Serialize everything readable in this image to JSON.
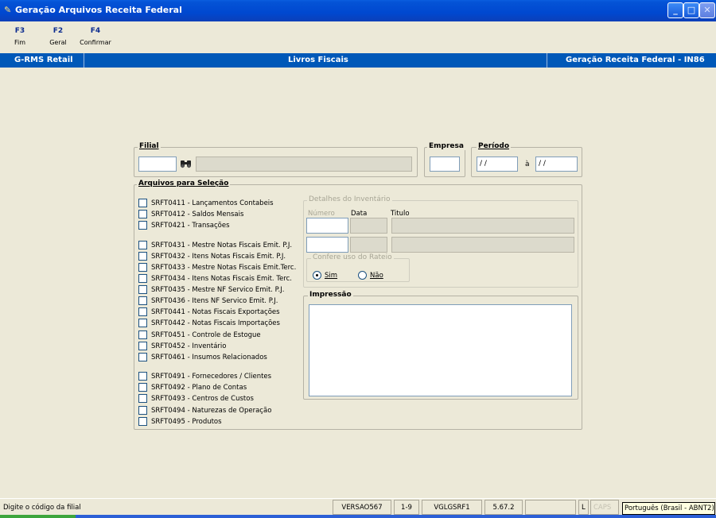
{
  "window": {
    "title": "Geração Arquivos Receita Federal",
    "controls": {
      "minimize": "_",
      "maximize": "□",
      "close": "✕"
    }
  },
  "function_keys": [
    {
      "key": "F3",
      "label": "Fim"
    },
    {
      "key": "F2",
      "label": "Geral"
    },
    {
      "key": "F4",
      "label": "Confirmar"
    }
  ],
  "module_bar": {
    "left": "G-RMS Retail",
    "center": "Livros Fiscais",
    "right": "Geração Receita Federal - IN86"
  },
  "filial": {
    "label": "Filial",
    "code": "",
    "description": ""
  },
  "empresa": {
    "label": "Empresa",
    "value": ""
  },
  "periodo": {
    "label": "Período",
    "from": "/ /",
    "separator": "à",
    "to": "/ /"
  },
  "arquivos": {
    "label": "Arquivos para Seleção",
    "items": [
      "SRFT0411 - Lançamentos Contabeis",
      "SRFT0412 - Saldos Mensais",
      "SRFT0421 - Transações",
      "SRFT0431 - Mestre Notas Fiscais Emit. P.J.",
      "SRFT0432 - Itens  Notas Fiscais Emit. P.J.",
      "SRFT0433 - Mestre Notas Fiscais Emit.Terc.",
      "SRFT0434 - Itens  Notas Fiscais Emit. Terc.",
      "SRFT0435 - Mestre  NF Servico Emit. P.J.",
      "SRFT0436 - Itens NF Servico Emit. P.J.",
      "SRFT0441 - Notas Fiscais Exportações",
      "SRFT0442 - Notas Fiscais Importações",
      "SRFT0451 - Controle de Estogue",
      "SRFT0452 - Inventário",
      "SRFT0461 - Insumos Relacionados",
      "SRFT0491 - Fornecedores / Clientes",
      "SRFT0492 - Plano de Contas",
      "SRFT0493 - Centros de Custos",
      "SRFT0494 - Naturezas de Operação",
      "SRFT0495 - Produtos"
    ]
  },
  "inventario": {
    "label": "Detalhes do Inventário",
    "col_numero": "Número",
    "col_data": "Data",
    "col_titulo": "Titulo",
    "rateio": {
      "label": "Confere uso do Rateio",
      "sim": "Sim",
      "nao": "Não",
      "selected": "Sim"
    }
  },
  "impressao": {
    "label": "Impressão",
    "text": ""
  },
  "status": {
    "message": "Digite o código da filial",
    "version": "VERSAO567",
    "page": "1-9",
    "program": "VGLGSRF1",
    "build": "5.67.2",
    "blank": "",
    "lock": "L",
    "caps": "CAPS",
    "tooltip": "Português (Brasil - ABNT2)"
  }
}
